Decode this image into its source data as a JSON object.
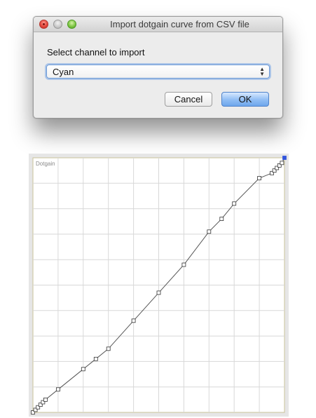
{
  "dialog": {
    "title": "Import dotgain curve from CSV file",
    "channel_label": "Select channel to import",
    "selected_channel": "Cyan",
    "cancel_label": "Cancel",
    "ok_label": "OK",
    "icons": [
      "close-window-icon",
      "minimize-window-icon",
      "zoom-window-icon",
      "select-arrows-icon"
    ]
  },
  "chart_data": {
    "type": "line",
    "title": "Dotgain",
    "xlabel": "",
    "ylabel": "",
    "xlim": [
      0,
      100
    ],
    "ylim": [
      0,
      100
    ],
    "grid": true,
    "legend": "none",
    "colors": {
      "line": "#555555",
      "grid": "#d8d8d8",
      "border": "#c9c39a",
      "endpoint": "#3355dd"
    },
    "series": [
      {
        "x": [
          0,
          1,
          2,
          3,
          4,
          5,
          10,
          20,
          25,
          30,
          40,
          50,
          60,
          70,
          75,
          80,
          90,
          95,
          96,
          97,
          98,
          99,
          100
        ],
        "y": [
          0,
          1,
          2,
          3,
          4,
          5,
          9,
          17,
          21,
          25,
          36,
          47,
          58,
          71,
          76,
          82,
          92,
          94,
          95,
          96,
          97,
          98,
          100
        ]
      }
    ]
  }
}
